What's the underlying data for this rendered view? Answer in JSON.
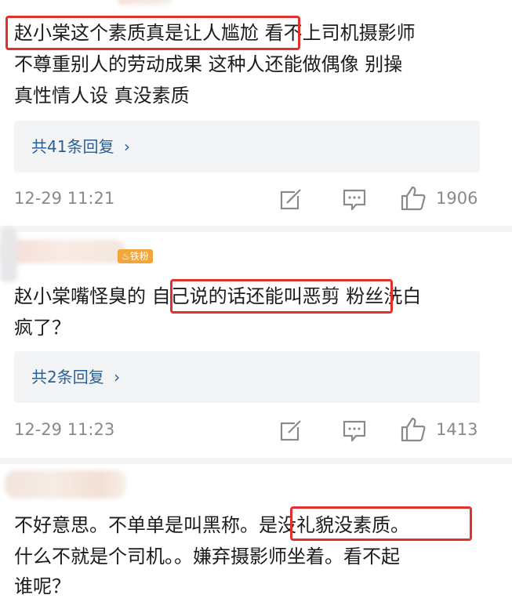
{
  "comments": [
    {
      "lines": [
        "赵小棠这个素质真是让人尴尬 看不上司机摄影师",
        "不尊重别人的劳动成果 这种人还能做偶像 别操",
        "真性情人设 真没素质"
      ],
      "highlight": "赵小棠这个素质真是让人尴尬",
      "replies": "共41条回复",
      "time": "12-29 11:21",
      "likes": "1906"
    },
    {
      "badge": "铁粉",
      "lines": [
        "赵小棠嘴怪臭的 自己说的话还能叫恶剪 粉丝洗白",
        "疯了？"
      ],
      "highlight": "自己说的话还能叫恶剪",
      "replies": "共2条回复",
      "time": "12-29 11:23",
      "likes": "1413"
    },
    {
      "lines": [
        "不好意思。不单单是叫黑称。是没礼貌没素质。",
        "什么不就是个司机。。嫌弃摄影师坐着。看不起",
        "谁呢？"
      ],
      "highlight": "是没礼貌没素质。"
    }
  ],
  "reply_arrow": "›",
  "icons": {
    "share": "share-icon",
    "comment": "comment-icon",
    "like": "thumbs-up-icon"
  },
  "colors": {
    "highlight_border": "#e0312f",
    "reply_link": "#2b5f98",
    "meta": "#8a8a8a",
    "badge": "#f1a63a"
  }
}
